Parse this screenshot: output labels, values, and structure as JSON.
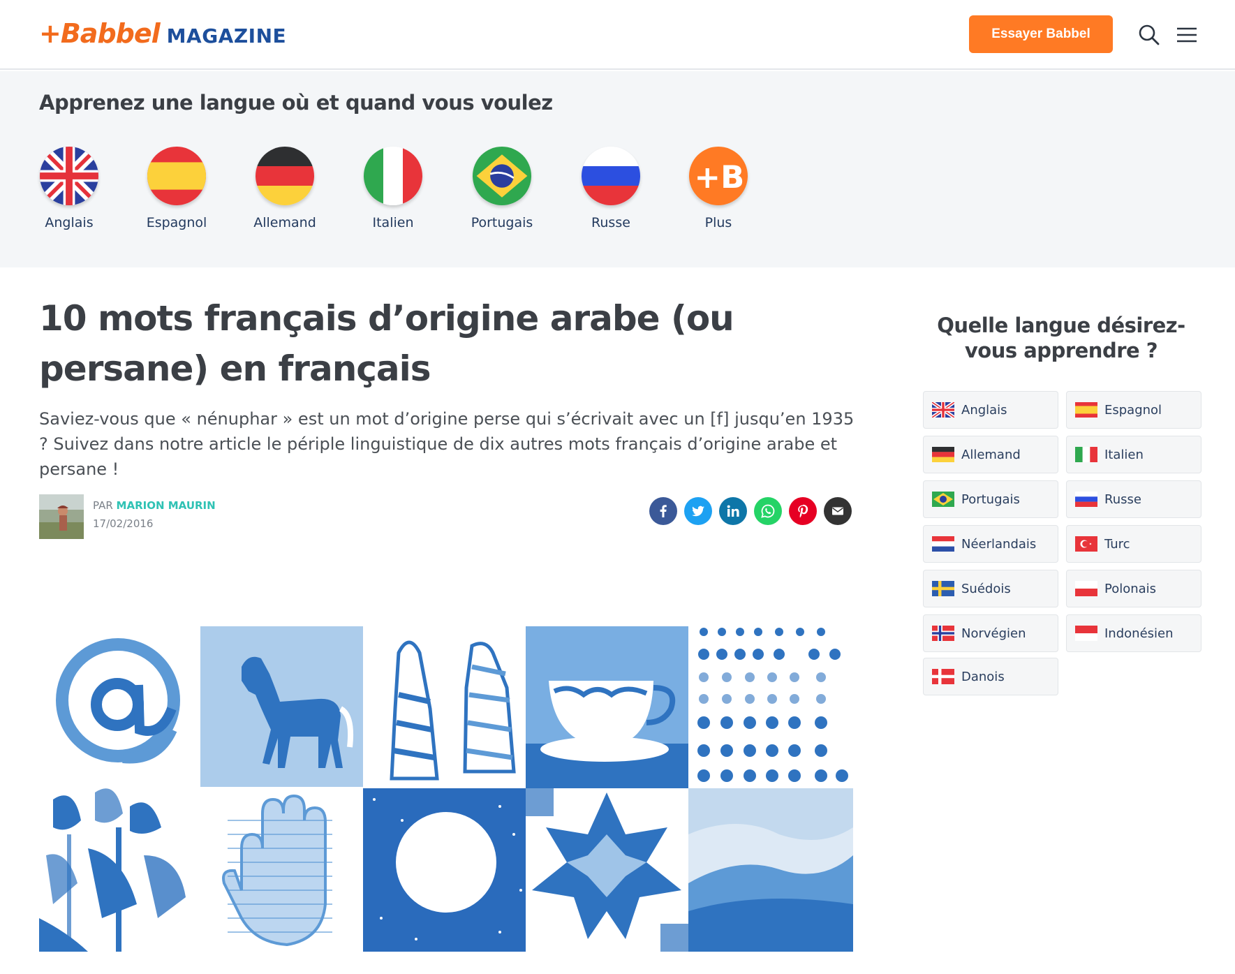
{
  "header": {
    "logo_mark": "+Babbel",
    "logo_magazine": "MAGAZINE",
    "cta_label": "Essayer Babbel",
    "brand_color": "#ff7a24",
    "search_icon": "search-icon",
    "menu_icon": "hamburger-menu-icon"
  },
  "langbar": {
    "title": "Apprenez une langue où et quand vous voulez",
    "items": [
      {
        "label": "Anglais",
        "flag": "uk"
      },
      {
        "label": "Espagnol",
        "flag": "es"
      },
      {
        "label": "Allemand",
        "flag": "de"
      },
      {
        "label": "Italien",
        "flag": "it"
      },
      {
        "label": "Portugais",
        "flag": "br"
      },
      {
        "label": "Russe",
        "flag": "ru"
      },
      {
        "label": "Plus",
        "flag": "babbel"
      }
    ]
  },
  "article": {
    "title": "10 mots français d’origine arabe (ou persane) en français",
    "lead": "Saviez-vous que « nénuphar » est un mot d’origine perse qui s’écrivait avec un [f] jusqu’en 1935 ? Suivez dans notre article le périple linguistique de dix autres mots français d’origine arabe et persane !",
    "author_prefix": "PAR ",
    "author_name": "MARION MAURIN",
    "date": "17/02/2016",
    "share": [
      {
        "name": "facebook",
        "color": "#3b5998"
      },
      {
        "name": "twitter",
        "color": "#1da1f2"
      },
      {
        "name": "linkedin",
        "color": "#0e76a8"
      },
      {
        "name": "whatsapp",
        "color": "#25d366"
      },
      {
        "name": "pinterest",
        "color": "#e60023"
      },
      {
        "name": "email",
        "color": "#333333"
      }
    ]
  },
  "sidebar": {
    "title": "Quelle langue désirez-vous apprendre ?",
    "languages": [
      {
        "label": "Anglais",
        "flag": "uk"
      },
      {
        "label": "Espagnol",
        "flag": "es"
      },
      {
        "label": "Allemand",
        "flag": "de"
      },
      {
        "label": "Italien",
        "flag": "it"
      },
      {
        "label": "Portugais",
        "flag": "br"
      },
      {
        "label": "Russe",
        "flag": "ru"
      },
      {
        "label": "Néerlandais",
        "flag": "nl"
      },
      {
        "label": "Turc",
        "flag": "tr"
      },
      {
        "label": "Suédois",
        "flag": "se"
      },
      {
        "label": "Polonais",
        "flag": "pl"
      },
      {
        "label": "Norvégien",
        "flag": "no"
      },
      {
        "label": "Indonésien",
        "flag": "id"
      },
      {
        "label": "Danois",
        "flag": "dk"
      }
    ]
  }
}
